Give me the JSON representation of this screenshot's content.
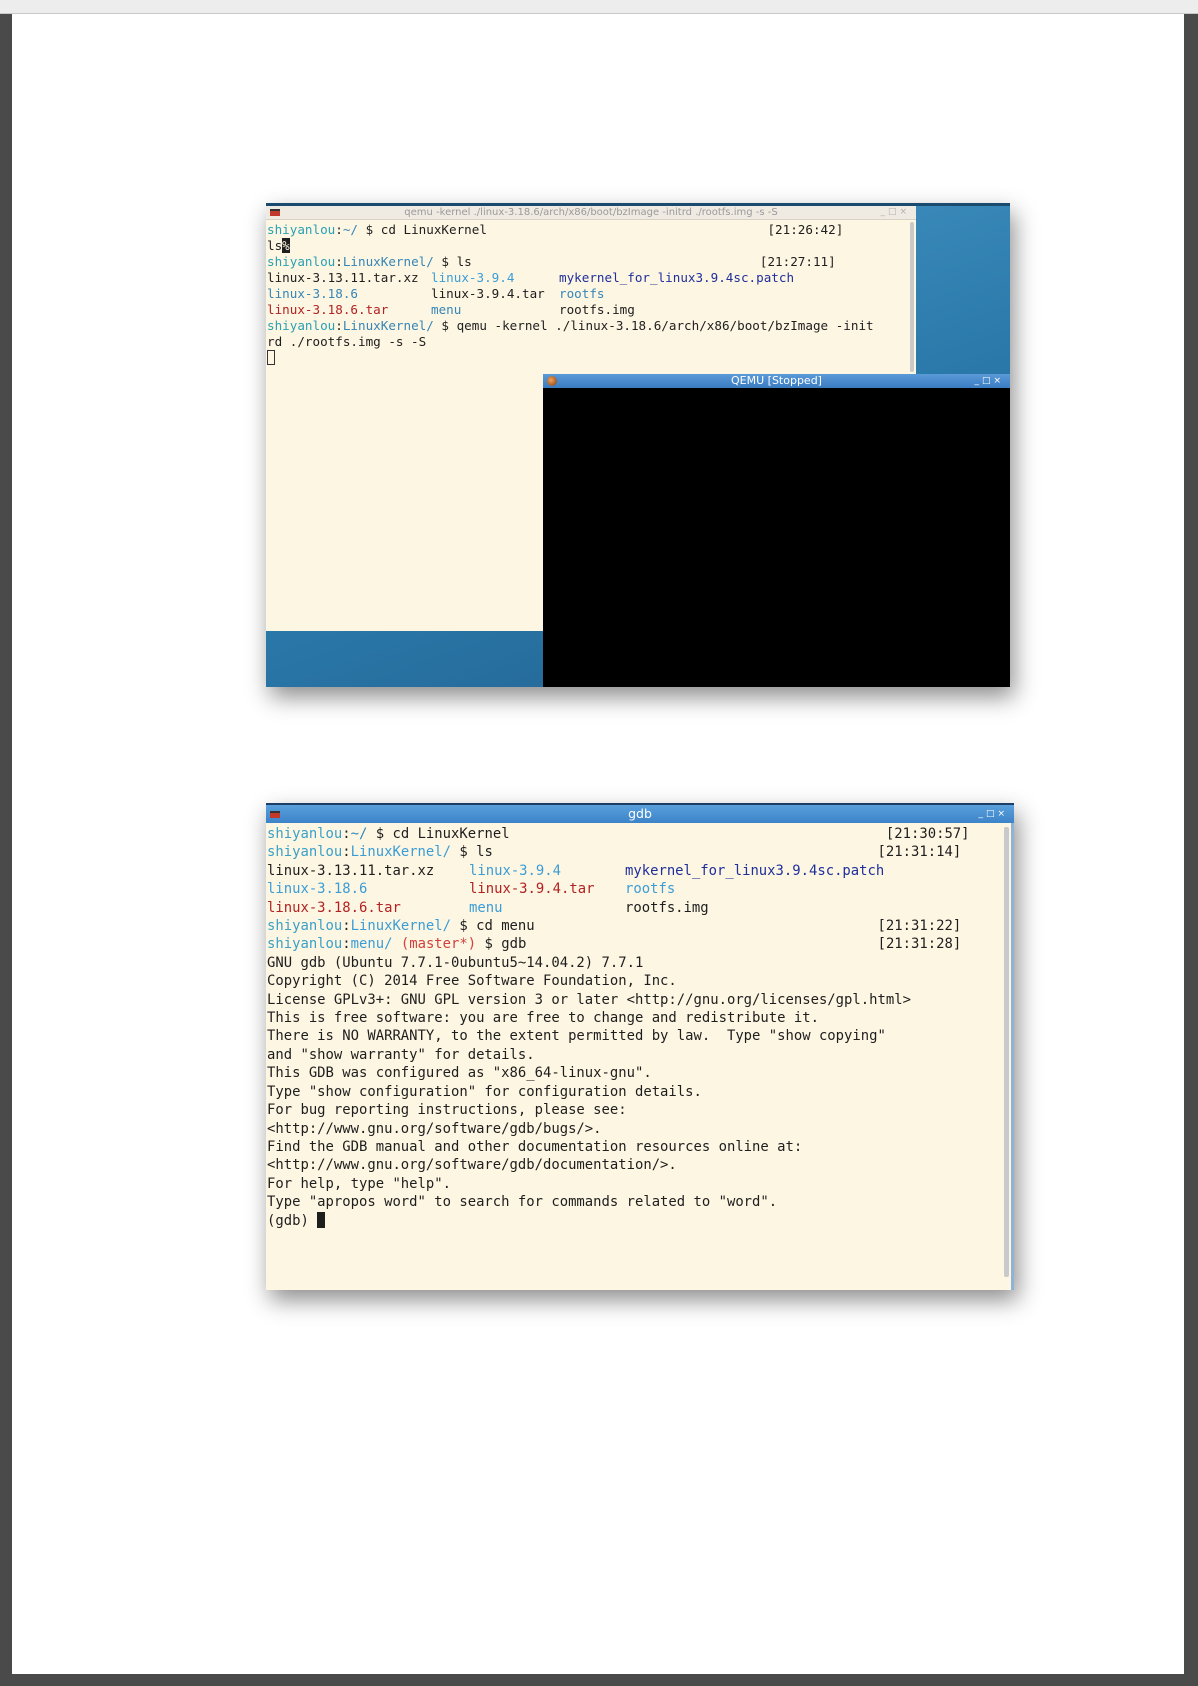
{
  "shot1": {
    "title": "qemu -kernel ./linux-3.18.6/arch/x86/boot/bzImage -initrd ./rootfs.img -s -S",
    "controls": [
      "_",
      "□",
      "×"
    ],
    "lines": {
      "l1_user": "shiyanlou",
      "l1_sep": ":",
      "l1_path": "~/",
      "l1_cmd": " $ cd LinuxKernel",
      "l1_time": "[21:26:42]",
      "l2_text": "ls",
      "l2_cursor": "%",
      "l3_user": "shiyanlou",
      "l3_sep": ":",
      "l3_path": "LinuxKernel/",
      "l3_cmd": " $ ls",
      "l3_time": "[21:27:11]",
      "ls": [
        [
          "linux-3.13.11.tar.xz",
          "linux-3.9.4",
          "mykernel_for_linux3.9.4sc.patch"
        ],
        [
          "linux-3.18.6",
          "linux-3.9.4.tar",
          "rootfs"
        ],
        [
          "linux-3.18.6.tar",
          "menu",
          "rootfs.img"
        ]
      ],
      "l7_user": "shiyanlou",
      "l7_sep": ":",
      "l7_path": "LinuxKernel/",
      "l7_cmd": " $ qemu -kernel ./linux-3.18.6/arch/x86/boot/bzImage -init",
      "l8_text": "rd ./rootfs.img -s -S"
    },
    "qemu": {
      "title": "QEMU [Stopped]",
      "controls": [
        "_",
        "□",
        "×"
      ]
    }
  },
  "shot2": {
    "title": "gdb",
    "controls": [
      "_",
      "□",
      "×"
    ],
    "p1_user": "shiyanlou",
    "p1_sep": ":",
    "p1_path": "~/",
    "p1_cmd": " $ cd LinuxKernel",
    "p1_time": "[21:30:57]",
    "p2_user": "shiyanlou",
    "p2_sep": ":",
    "p2_path": "LinuxKernel/",
    "p2_cmd": " $ ls",
    "p2_time": "[21:31:14]",
    "ls": [
      [
        "linux-3.13.11.tar.xz",
        "linux-3.9.4",
        "mykernel_for_linux3.9.4sc.patch"
      ],
      [
        "linux-3.18.6",
        "linux-3.9.4.tar",
        "rootfs"
      ],
      [
        "linux-3.18.6.tar",
        "menu",
        "rootfs.img"
      ]
    ],
    "p3_user": "shiyanlou",
    "p3_sep": ":",
    "p3_path": "LinuxKernel/",
    "p3_cmd": " $ cd menu",
    "p3_time": "[21:31:22]",
    "p4_user": "shiyanlou",
    "p4_sep": ":",
    "p4_path": "menu/",
    "p4_git_open": " (",
    "p4_git": "master*",
    "p4_git_close": ")",
    "p4_cmd": " $ gdb",
    "p4_time": "[21:31:28]",
    "gdb_output": [
      "GNU gdb (Ubuntu 7.7.1-0ubuntu5~14.04.2) 7.7.1",
      "Copyright (C) 2014 Free Software Foundation, Inc.",
      "License GPLv3+: GNU GPL version 3 or later <http://gnu.org/licenses/gpl.html>",
      "This is free software: you are free to change and redistribute it.",
      "There is NO WARRANTY, to the extent permitted by law.  Type \"show copying\"",
      "and \"show warranty\" for details.",
      "This GDB was configured as \"x86_64-linux-gnu\".",
      "Type \"show configuration\" for configuration details.",
      "For bug reporting instructions, please see:",
      "<http://www.gnu.org/software/gdb/bugs/>.",
      "Find the GDB manual and other documentation resources online at:",
      "<http://www.gnu.org/software/gdb/documentation/>.",
      "For help, type \"help\".",
      "Type \"apropos word\" to search for commands related to \"word\"."
    ],
    "gdb_prompt": "(gdb) "
  }
}
